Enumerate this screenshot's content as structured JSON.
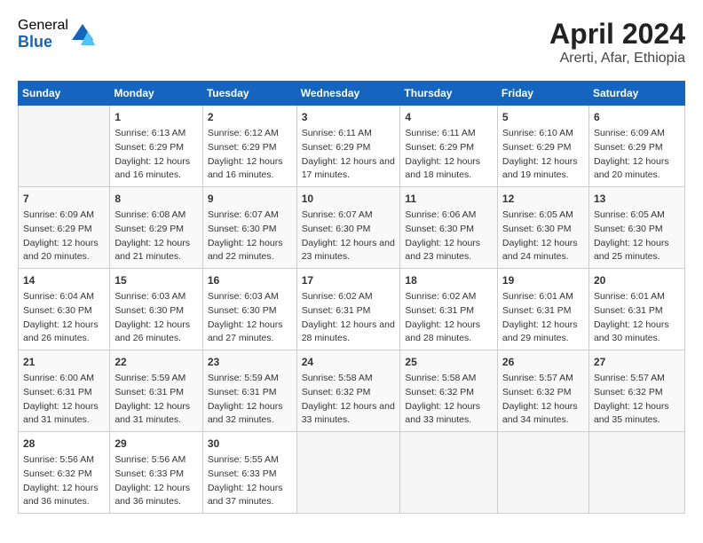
{
  "header": {
    "logo_general": "General",
    "logo_blue": "Blue",
    "month_year": "April 2024",
    "location": "Arerti, Afar, Ethiopia"
  },
  "calendar": {
    "days_of_week": [
      "Sunday",
      "Monday",
      "Tuesday",
      "Wednesday",
      "Thursday",
      "Friday",
      "Saturday"
    ],
    "weeks": [
      [
        {
          "day": "",
          "sunrise": "",
          "sunset": "",
          "daylight": ""
        },
        {
          "day": "1",
          "sunrise": "Sunrise: 6:13 AM",
          "sunset": "Sunset: 6:29 PM",
          "daylight": "Daylight: 12 hours and 16 minutes."
        },
        {
          "day": "2",
          "sunrise": "Sunrise: 6:12 AM",
          "sunset": "Sunset: 6:29 PM",
          "daylight": "Daylight: 12 hours and 16 minutes."
        },
        {
          "day": "3",
          "sunrise": "Sunrise: 6:11 AM",
          "sunset": "Sunset: 6:29 PM",
          "daylight": "Daylight: 12 hours and 17 minutes."
        },
        {
          "day": "4",
          "sunrise": "Sunrise: 6:11 AM",
          "sunset": "Sunset: 6:29 PM",
          "daylight": "Daylight: 12 hours and 18 minutes."
        },
        {
          "day": "5",
          "sunrise": "Sunrise: 6:10 AM",
          "sunset": "Sunset: 6:29 PM",
          "daylight": "Daylight: 12 hours and 19 minutes."
        },
        {
          "day": "6",
          "sunrise": "Sunrise: 6:09 AM",
          "sunset": "Sunset: 6:29 PM",
          "daylight": "Daylight: 12 hours and 20 minutes."
        }
      ],
      [
        {
          "day": "7",
          "sunrise": "Sunrise: 6:09 AM",
          "sunset": "Sunset: 6:29 PM",
          "daylight": "Daylight: 12 hours and 20 minutes."
        },
        {
          "day": "8",
          "sunrise": "Sunrise: 6:08 AM",
          "sunset": "Sunset: 6:29 PM",
          "daylight": "Daylight: 12 hours and 21 minutes."
        },
        {
          "day": "9",
          "sunrise": "Sunrise: 6:07 AM",
          "sunset": "Sunset: 6:30 PM",
          "daylight": "Daylight: 12 hours and 22 minutes."
        },
        {
          "day": "10",
          "sunrise": "Sunrise: 6:07 AM",
          "sunset": "Sunset: 6:30 PM",
          "daylight": "Daylight: 12 hours and 23 minutes."
        },
        {
          "day": "11",
          "sunrise": "Sunrise: 6:06 AM",
          "sunset": "Sunset: 6:30 PM",
          "daylight": "Daylight: 12 hours and 23 minutes."
        },
        {
          "day": "12",
          "sunrise": "Sunrise: 6:05 AM",
          "sunset": "Sunset: 6:30 PM",
          "daylight": "Daylight: 12 hours and 24 minutes."
        },
        {
          "day": "13",
          "sunrise": "Sunrise: 6:05 AM",
          "sunset": "Sunset: 6:30 PM",
          "daylight": "Daylight: 12 hours and 25 minutes."
        }
      ],
      [
        {
          "day": "14",
          "sunrise": "Sunrise: 6:04 AM",
          "sunset": "Sunset: 6:30 PM",
          "daylight": "Daylight: 12 hours and 26 minutes."
        },
        {
          "day": "15",
          "sunrise": "Sunrise: 6:03 AM",
          "sunset": "Sunset: 6:30 PM",
          "daylight": "Daylight: 12 hours and 26 minutes."
        },
        {
          "day": "16",
          "sunrise": "Sunrise: 6:03 AM",
          "sunset": "Sunset: 6:30 PM",
          "daylight": "Daylight: 12 hours and 27 minutes."
        },
        {
          "day": "17",
          "sunrise": "Sunrise: 6:02 AM",
          "sunset": "Sunset: 6:31 PM",
          "daylight": "Daylight: 12 hours and 28 minutes."
        },
        {
          "day": "18",
          "sunrise": "Sunrise: 6:02 AM",
          "sunset": "Sunset: 6:31 PM",
          "daylight": "Daylight: 12 hours and 28 minutes."
        },
        {
          "day": "19",
          "sunrise": "Sunrise: 6:01 AM",
          "sunset": "Sunset: 6:31 PM",
          "daylight": "Daylight: 12 hours and 29 minutes."
        },
        {
          "day": "20",
          "sunrise": "Sunrise: 6:01 AM",
          "sunset": "Sunset: 6:31 PM",
          "daylight": "Daylight: 12 hours and 30 minutes."
        }
      ],
      [
        {
          "day": "21",
          "sunrise": "Sunrise: 6:00 AM",
          "sunset": "Sunset: 6:31 PM",
          "daylight": "Daylight: 12 hours and 31 minutes."
        },
        {
          "day": "22",
          "sunrise": "Sunrise: 5:59 AM",
          "sunset": "Sunset: 6:31 PM",
          "daylight": "Daylight: 12 hours and 31 minutes."
        },
        {
          "day": "23",
          "sunrise": "Sunrise: 5:59 AM",
          "sunset": "Sunset: 6:31 PM",
          "daylight": "Daylight: 12 hours and 32 minutes."
        },
        {
          "day": "24",
          "sunrise": "Sunrise: 5:58 AM",
          "sunset": "Sunset: 6:32 PM",
          "daylight": "Daylight: 12 hours and 33 minutes."
        },
        {
          "day": "25",
          "sunrise": "Sunrise: 5:58 AM",
          "sunset": "Sunset: 6:32 PM",
          "daylight": "Daylight: 12 hours and 33 minutes."
        },
        {
          "day": "26",
          "sunrise": "Sunrise: 5:57 AM",
          "sunset": "Sunset: 6:32 PM",
          "daylight": "Daylight: 12 hours and 34 minutes."
        },
        {
          "day": "27",
          "sunrise": "Sunrise: 5:57 AM",
          "sunset": "Sunset: 6:32 PM",
          "daylight": "Daylight: 12 hours and 35 minutes."
        }
      ],
      [
        {
          "day": "28",
          "sunrise": "Sunrise: 5:56 AM",
          "sunset": "Sunset: 6:32 PM",
          "daylight": "Daylight: 12 hours and 36 minutes."
        },
        {
          "day": "29",
          "sunrise": "Sunrise: 5:56 AM",
          "sunset": "Sunset: 6:33 PM",
          "daylight": "Daylight: 12 hours and 36 minutes."
        },
        {
          "day": "30",
          "sunrise": "Sunrise: 5:55 AM",
          "sunset": "Sunset: 6:33 PM",
          "daylight": "Daylight: 12 hours and 37 minutes."
        },
        {
          "day": "",
          "sunrise": "",
          "sunset": "",
          "daylight": ""
        },
        {
          "day": "",
          "sunrise": "",
          "sunset": "",
          "daylight": ""
        },
        {
          "day": "",
          "sunrise": "",
          "sunset": "",
          "daylight": ""
        },
        {
          "day": "",
          "sunrise": "",
          "sunset": "",
          "daylight": ""
        }
      ]
    ]
  }
}
